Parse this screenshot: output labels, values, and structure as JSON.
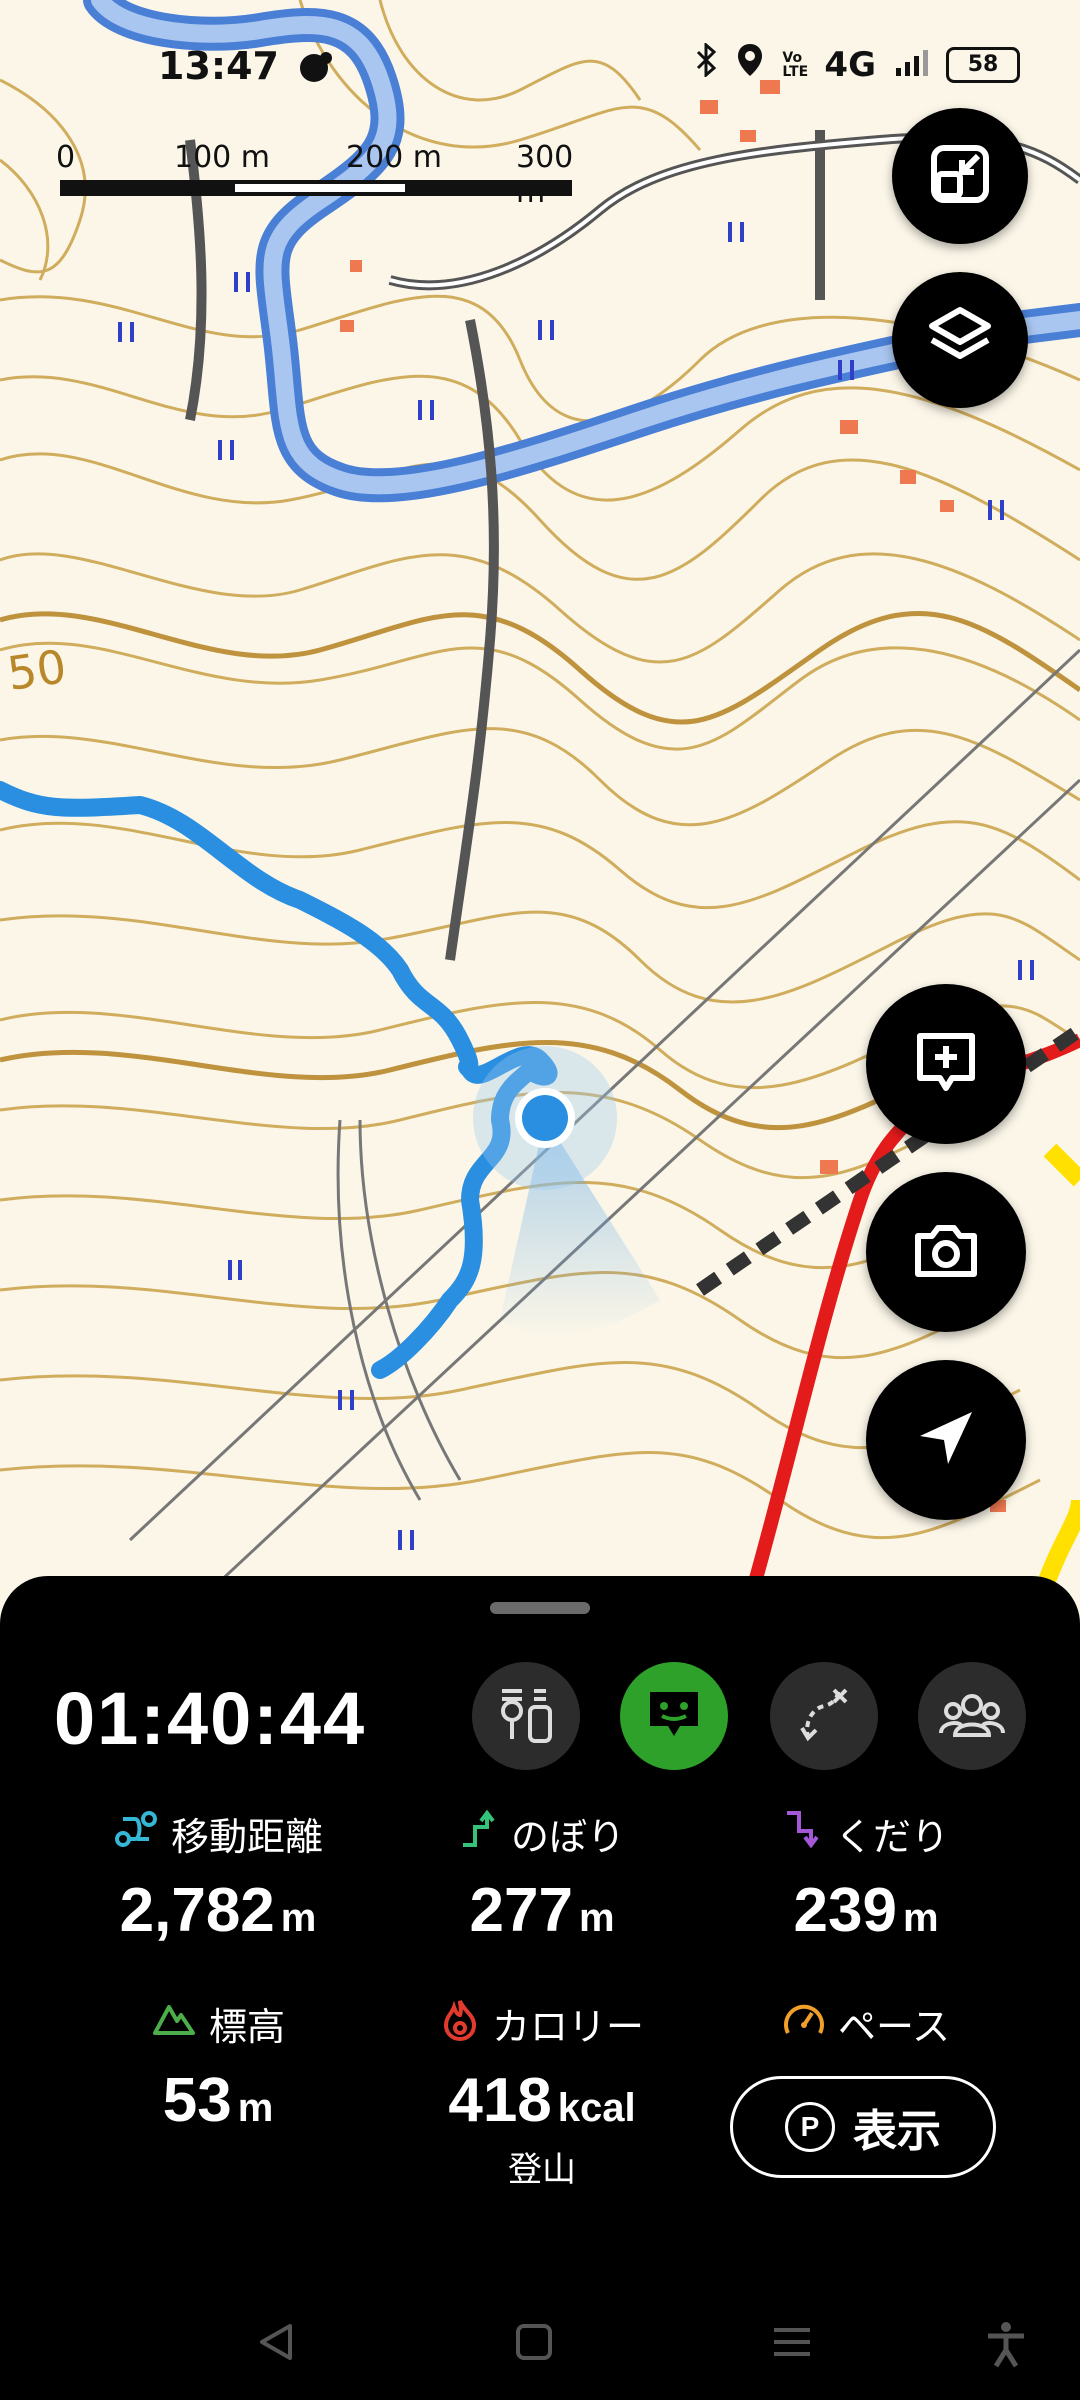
{
  "status_bar": {
    "time": "13:47",
    "network": "4G",
    "volte": "Vo LTE",
    "battery": "58",
    "icons": [
      "notification-icon",
      "bluetooth-icon",
      "location-icon",
      "volte-icon",
      "signal-icon",
      "battery-icon"
    ]
  },
  "map": {
    "scale_labels": [
      "0",
      "100 m",
      "200 m",
      "300 m"
    ],
    "contour_label": "50",
    "track_color": "#2a8fe0",
    "position_color": "#2a8fe0"
  },
  "map_controls": {
    "icons": [
      "collapse-icon",
      "layers-icon",
      "add-memo-icon",
      "camera-icon",
      "navigation-arrow-icon"
    ]
  },
  "panel": {
    "timer": "01:40:44",
    "mode_icons": [
      "gear-status-icon",
      "chat-bubble-icon",
      "route-off-icon",
      "group-icon"
    ],
    "stats": {
      "distance": {
        "label": "移動距離",
        "value": "2,782",
        "unit": "m",
        "icon": "route-icon",
        "icon_color": "#35b7d6"
      },
      "ascent": {
        "label": "のぼり",
        "value": "277",
        "unit": "m",
        "icon": "ascent-icon",
        "icon_color": "#35c27a"
      },
      "descent": {
        "label": "くだり",
        "value": "239",
        "unit": "m",
        "icon": "descent-icon",
        "icon_color": "#a457d6"
      },
      "altitude": {
        "label": "標高",
        "value": "53",
        "unit": "m",
        "icon": "mountain-icon",
        "icon_color": "#4cad4a"
      },
      "calorie": {
        "label": "カロリー",
        "value": "418",
        "unit": "kcal",
        "sub": "登山",
        "icon": "flame-icon",
        "icon_color": "#e23b2d"
      },
      "pace": {
        "label": "ペース",
        "icon": "speedometer-icon",
        "icon_color": "#f0a02a",
        "button_badge": "P",
        "button_label": "表示"
      }
    }
  },
  "nav_bar": {
    "icons": [
      "back-icon",
      "home-icon",
      "recents-icon",
      "accessibility-icon"
    ]
  }
}
